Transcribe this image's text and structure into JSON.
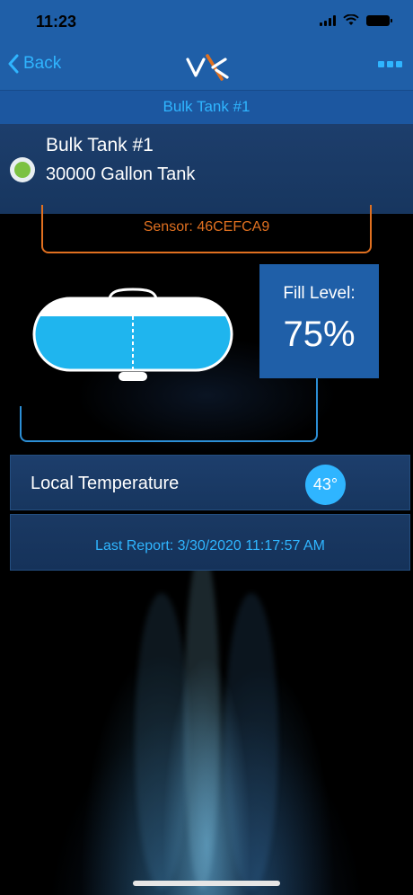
{
  "status_bar": {
    "time": "11:23"
  },
  "nav": {
    "back_label": "Back",
    "logo": "vx-logo",
    "more_icon": "more-dots-icon"
  },
  "subtitle": "Bulk Tank #1",
  "tank": {
    "name": "Bulk Tank #1",
    "capacity": "30000 Gallon Tank",
    "status_color": "#7cc242"
  },
  "sensor": {
    "label": "Sensor: 46CEFCA9"
  },
  "fill": {
    "label": "Fill Level:",
    "value_text": "75%",
    "level": 0.75
  },
  "temperature": {
    "label": "Local Temperature",
    "value": "43°"
  },
  "report": {
    "text": "Last Report: 3/30/2020 11:17:57 AM"
  },
  "colors": {
    "accent": "#2fb5ff",
    "nav_blue": "#1f5fa8",
    "sensor_orange": "#e07020",
    "status_green": "#7cc242"
  }
}
